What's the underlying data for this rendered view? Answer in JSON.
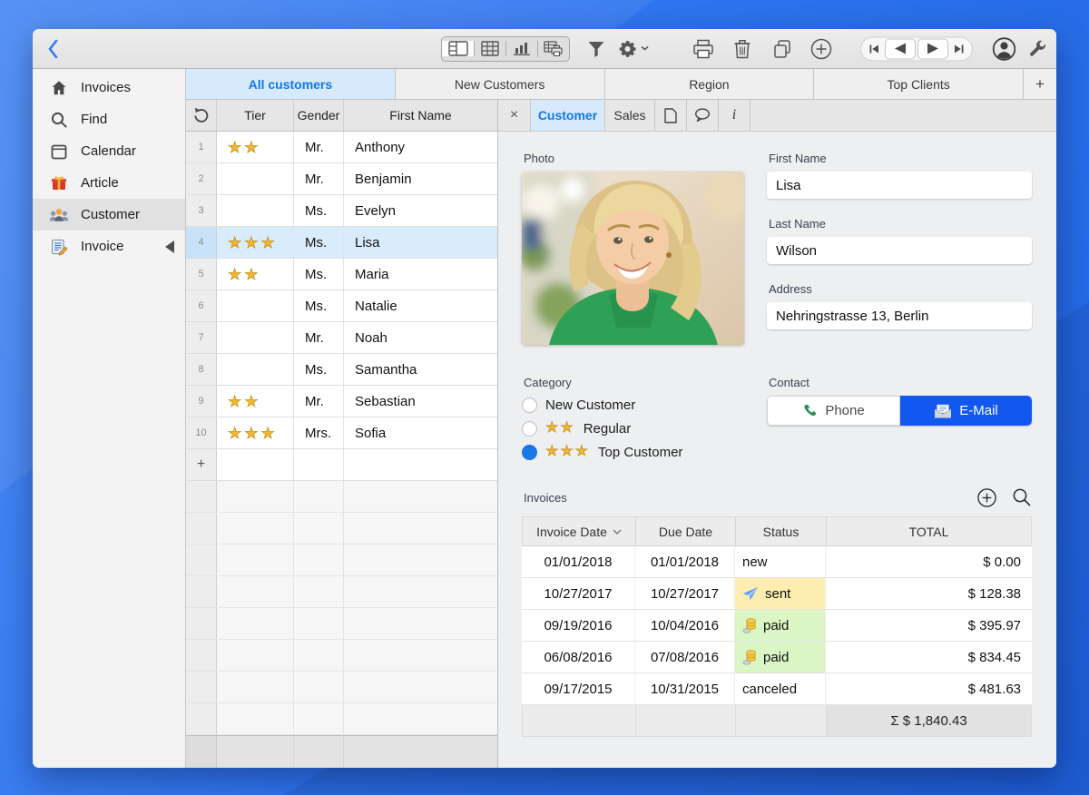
{
  "toolbar": {
    "view_modes": [
      "form-view",
      "table-view",
      "chart-view",
      "print-view"
    ],
    "selected_view": 0,
    "icons": [
      "back",
      "filter",
      "settings",
      "settings-dropdown",
      "print",
      "delete",
      "duplicate",
      "add-record",
      "first-record",
      "previous-record",
      "next-record",
      "last-record",
      "account",
      "tools"
    ]
  },
  "sidebar": {
    "items": [
      {
        "label": "Invoices",
        "icon": "home",
        "selected": false,
        "arrow": false
      },
      {
        "label": "Find",
        "icon": "search",
        "selected": false,
        "arrow": false
      },
      {
        "label": "Calendar",
        "icon": "calendar",
        "selected": false,
        "arrow": false
      },
      {
        "label": "Article",
        "icon": "gift",
        "selected": false,
        "arrow": false
      },
      {
        "label": "Customer",
        "icon": "people",
        "selected": true,
        "arrow": false
      },
      {
        "label": "Invoice",
        "icon": "invoice",
        "selected": false,
        "arrow": true
      }
    ]
  },
  "view_tabs": [
    {
      "label": "All customers",
      "selected": true
    },
    {
      "label": "New Customers",
      "selected": false
    },
    {
      "label": "Region",
      "selected": false
    },
    {
      "label": "Top Clients",
      "selected": false
    }
  ],
  "add_tab_label": "+",
  "customer_table": {
    "headers": [
      "Tier",
      "Gender",
      "First Name"
    ],
    "rows": [
      {
        "num": "1",
        "stars": 2,
        "gender": "Mr.",
        "first_name": "Anthony",
        "selected": false
      },
      {
        "num": "2",
        "stars": 0,
        "gender": "Mr.",
        "first_name": "Benjamin",
        "selected": false
      },
      {
        "num": "3",
        "stars": 0,
        "gender": "Ms.",
        "first_name": "Evelyn",
        "selected": false
      },
      {
        "num": "4",
        "stars": 3,
        "gender": "Ms.",
        "first_name": "Lisa",
        "selected": true
      },
      {
        "num": "5",
        "stars": 2,
        "gender": "Ms.",
        "first_name": "Maria",
        "selected": false
      },
      {
        "num": "6",
        "stars": 0,
        "gender": "Ms.",
        "first_name": "Natalie",
        "selected": false
      },
      {
        "num": "7",
        "stars": 0,
        "gender": "Mr.",
        "first_name": "Noah",
        "selected": false
      },
      {
        "num": "8",
        "stars": 0,
        "gender": "Ms.",
        "first_name": "Samantha",
        "selected": false
      },
      {
        "num": "9",
        "stars": 2,
        "gender": "Mr.",
        "first_name": "Sebastian",
        "selected": false
      },
      {
        "num": "10",
        "stars": 3,
        "gender": "Mrs.",
        "first_name": "Sofia",
        "selected": false
      }
    ],
    "add_row_label": "+",
    "empty_rows": 8
  },
  "detail": {
    "tabs": {
      "close": "×",
      "items": [
        {
          "label": "Customer",
          "selected": true
        },
        {
          "label": "Sales",
          "selected": false
        }
      ],
      "icon_tabs": [
        "document",
        "comment",
        "info"
      ]
    },
    "photo_label": "Photo",
    "fields": {
      "first_name": {
        "label": "First Name",
        "value": "Lisa"
      },
      "last_name": {
        "label": "Last Name",
        "value": "Wilson"
      },
      "address": {
        "label": "Address",
        "value": "Nehringstrasse 13, Berlin"
      }
    },
    "category": {
      "label": "Category",
      "options": [
        {
          "stars": 0,
          "label": "New Customer",
          "selected": false
        },
        {
          "stars": 2,
          "label": "Regular",
          "selected": false
        },
        {
          "stars": 3,
          "label": "Top Customer",
          "selected": true
        }
      ]
    },
    "contact": {
      "label": "Contact",
      "phone_label": "Phone",
      "email_label": "E-Mail"
    },
    "invoices": {
      "label": "Invoices",
      "headers": [
        "Invoice Date",
        "Due Date",
        "Status",
        "TOTAL"
      ],
      "rows": [
        {
          "invoice_date": "01/01/2018",
          "due_date": "01/01/2018",
          "status": "new",
          "status_style": "plain",
          "total": "$ 0.00"
        },
        {
          "invoice_date": "10/27/2017",
          "due_date": "10/27/2017",
          "status": "sent",
          "status_style": "sent",
          "total": "$ 128.38"
        },
        {
          "invoice_date": "09/19/2016",
          "due_date": "10/04/2016",
          "status": "paid",
          "status_style": "paid",
          "total": "$ 395.97"
        },
        {
          "invoice_date": "06/08/2016",
          "due_date": "07/08/2016",
          "status": "paid",
          "status_style": "paid",
          "total": "$ 834.45"
        },
        {
          "invoice_date": "09/17/2015",
          "due_date": "10/31/2015",
          "status": "canceled",
          "status_style": "plain",
          "total": "$ 481.63"
        }
      ],
      "sum": "Σ $ 1,840.43"
    }
  },
  "colors": {
    "accent_blue": "#1377e8",
    "selection_blue": "#d9ecfb",
    "email_button_blue": "#1157f0",
    "status_sent_bg": "#fdedb1",
    "status_paid_bg": "#d9f6c4",
    "star_gold": "#f2b632"
  }
}
